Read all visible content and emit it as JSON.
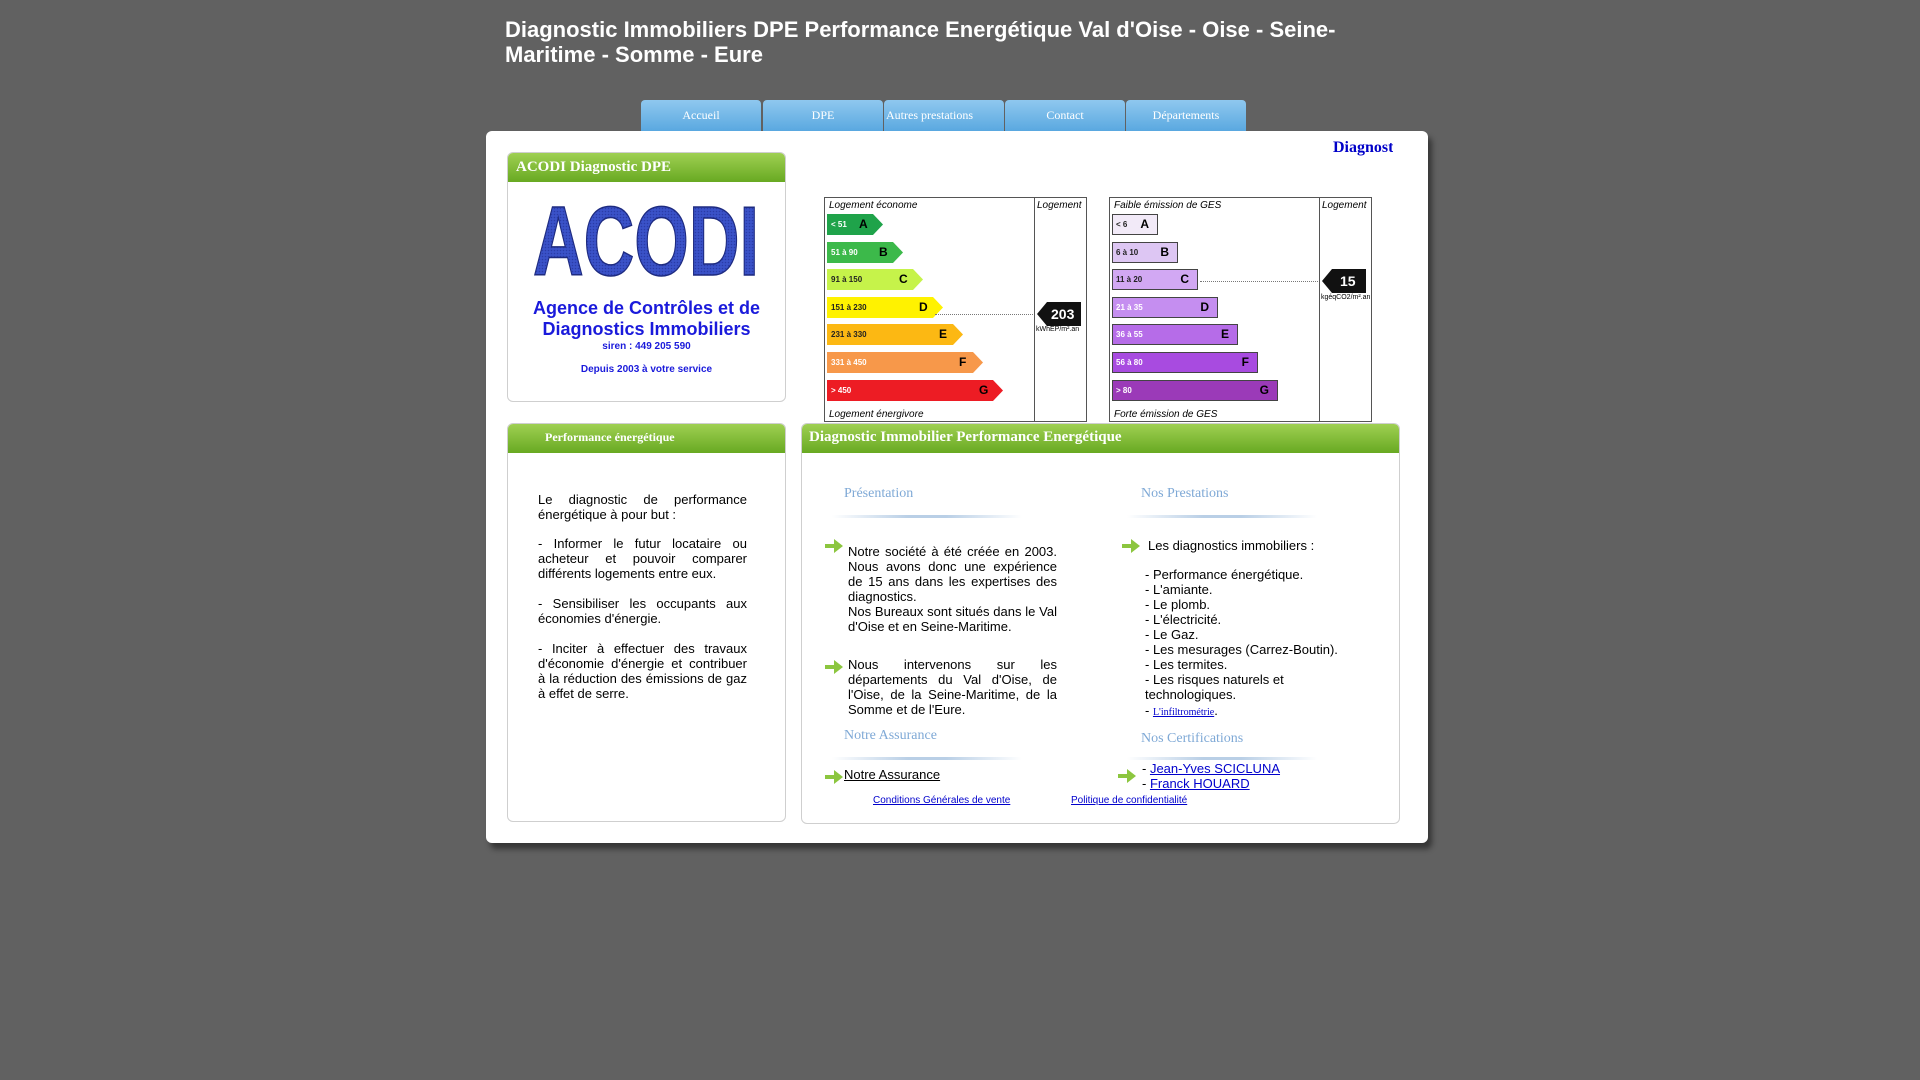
{
  "site": {
    "title": "Diagnostic Immobiliers DPE Performance Energétique Val d'Oise - Oise - Seine-Maritime - Somme - Eure"
  },
  "nav": {
    "items": [
      "Accueil",
      "DPE",
      "Autres prestations",
      "Contact",
      "Départements"
    ]
  },
  "marquee": "Diagnost",
  "acodi": {
    "heading": "ACODI Diagnostic DPE",
    "logo": "ACODI",
    "agency": "Agence de Contrôles et de Diagnostics Immobiliers",
    "siren": "siren : 449 205 590",
    "since": "Depuis 2003 à votre service"
  },
  "energy_label": {
    "top": "Logement économe",
    "bottom": "Logement énergivore",
    "column": "Logement",
    "value": "203",
    "unit": "kWhEP/m².an",
    "classes": [
      {
        "range": "< 51",
        "letter": "A",
        "color": "#1fa34a"
      },
      {
        "range": "51 à 90",
        "letter": "B",
        "color": "#3cb94a"
      },
      {
        "range": "91 à 150",
        "letter": "C",
        "color": "#c6f34a"
      },
      {
        "range": "151 à 230",
        "letter": "D",
        "color": "#fff200"
      },
      {
        "range": "231 à 330",
        "letter": "E",
        "color": "#fcb813"
      },
      {
        "range": "331 à 450",
        "letter": "F",
        "color": "#f7984a"
      },
      {
        "range": "> 450",
        "letter": "G",
        "color": "#ed1c24"
      }
    ]
  },
  "ges_label": {
    "top": "Faible émission de GES",
    "bottom": "Forte émission de GES",
    "column": "Logement",
    "value": "15",
    "unit": "kgéqCO2/m².an",
    "classes": [
      {
        "range": "< 6",
        "letter": "A",
        "color": "#f2eaf8"
      },
      {
        "range": "6 à 10",
        "letter": "B",
        "color": "#ddc6f3"
      },
      {
        "range": "11 à 20",
        "letter": "C",
        "color": "#d2a8f3"
      },
      {
        "range": "21 à 35",
        "letter": "D",
        "color": "#c58ef0"
      },
      {
        "range": "36 à 55",
        "letter": "E",
        "color": "#b66ce8"
      },
      {
        "range": "56 à 80",
        "letter": "F",
        "color": "#a84be0"
      },
      {
        "range": "> 80",
        "letter": "G",
        "color": "#9b3ab8"
      }
    ]
  },
  "performance": {
    "heading": "Performance énergétique",
    "intro": "Le diagnostic de performance énergétique à pour but :",
    "points": [
      "- Informer le futur locataire ou acheteur et pouvoir comparer différents logements entre eux.",
      "- Sensibiliser les occupants aux économies d'énergie.",
      "- Inciter à effectuer des travaux d'économie d'énergie et contribuer à la réduction des émissions de gaz à effet de serre."
    ]
  },
  "main": {
    "heading": "Diagnostic Immobilier Performance Energétique",
    "presentation": {
      "title": "Présentation",
      "p1": "Notre société à été créée en 2003. Nous avons donc une expérience de 15 ans dans les expertises des diagnostics.",
      "p2": "Nos Bureaux sont situés dans le Val d'Oise et en Seine-Maritime.",
      "p3": "Nous intervenons sur les départements du Val d'Oise, de l'Oise, de la Seine-Maritime, de la Somme et de l'Eure."
    },
    "prestations": {
      "title": "Nos Prestations",
      "intro": "Les diagnostics immobiliers :",
      "items": [
        "- Performance énergétique.",
        "- L'amiante.",
        "- Le plomb.",
        "- L'électricité.",
        "- Le Gaz.",
        "- Les mesurages (Carrez-Boutin).",
        "- Les termites.",
        "- Les risques naturels et technologiques."
      ],
      "infiltrometrie_prefix": "- ",
      "infiltrometrie_link": "L'infiltrométrie",
      "infiltrometrie_suffix": "."
    },
    "assurance": {
      "title": "Notre Assurance",
      "link": "Notre Assurance"
    },
    "certifications": {
      "title": "Nos Certifications",
      "prefix": "- ",
      "people": [
        "Jean-Yves SCICLUNA",
        "Franck HOUARD"
      ]
    },
    "footer": {
      "cgv": "Conditions Générales de vente",
      "privacy": "Politique de confidentialité"
    }
  },
  "colors": {
    "background": "#616161",
    "nav": "#6fb4e6",
    "panel_head": "#7cbc36",
    "link": "#0000cc"
  }
}
